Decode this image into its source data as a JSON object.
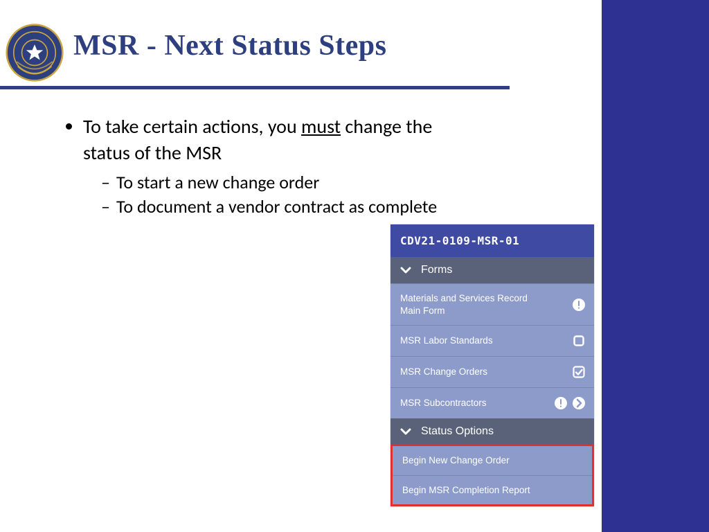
{
  "title": "MSR - Next Status Steps",
  "bullets": {
    "outer_pre": "To take certain actions, you ",
    "outer_must": "must",
    "outer_post": " change the status of the MSR",
    "sub1": "To start a new change order",
    "sub2": "To document a vendor contract as complete"
  },
  "panel": {
    "header": "CDV21-0109-MSR-01",
    "sections": {
      "forms": "Forms",
      "status": "Status Options"
    },
    "forms_items": [
      {
        "label": "Materials and Services Record Main Form",
        "icons": [
          "alert"
        ]
      },
      {
        "label": "MSR Labor Standards",
        "icons": [
          "square"
        ]
      },
      {
        "label": "MSR Change Orders",
        "icons": [
          "check"
        ]
      },
      {
        "label": "MSR Subcontractors",
        "icons": [
          "alert",
          "arrow"
        ]
      }
    ],
    "status_items": [
      {
        "label": "Begin New Change Order"
      },
      {
        "label": "Begin MSR Completion Report"
      }
    ]
  }
}
